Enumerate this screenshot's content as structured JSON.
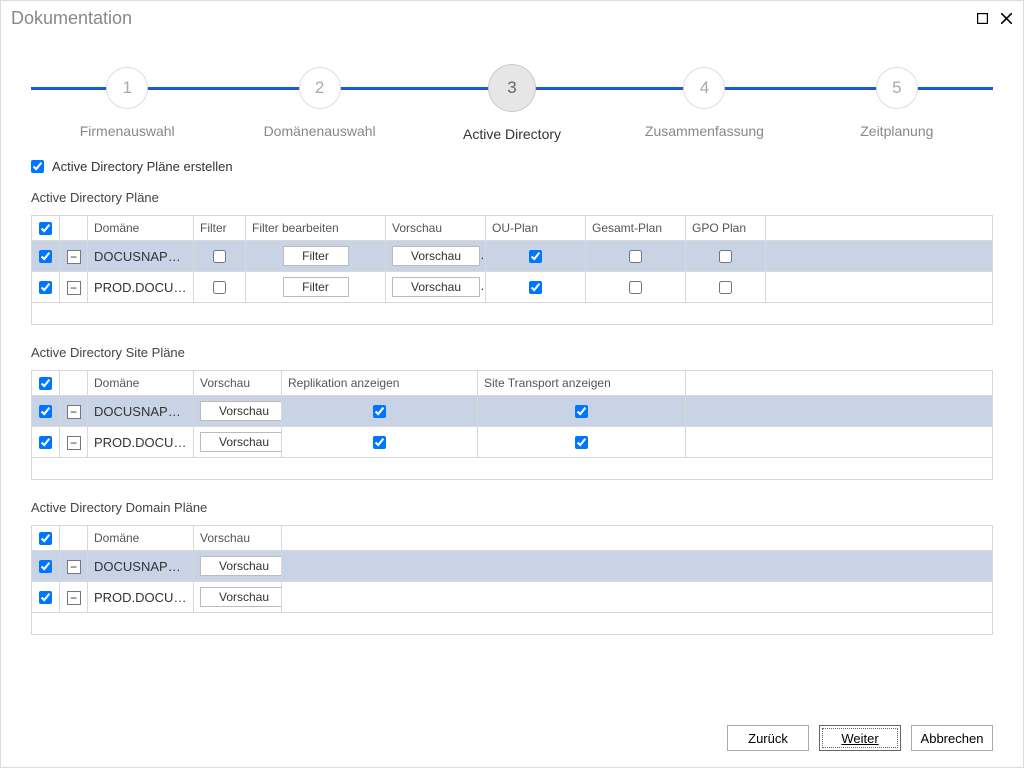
{
  "window": {
    "title": "Dokumentation"
  },
  "stepper": {
    "steps": [
      {
        "num": "1",
        "label": "Firmenauswahl"
      },
      {
        "num": "2",
        "label": "Domänenauswahl"
      },
      {
        "num": "3",
        "label": "Active Directory"
      },
      {
        "num": "4",
        "label": "Zusammenfassung"
      },
      {
        "num": "5",
        "label": "Zeitplanung"
      }
    ],
    "active": 2
  },
  "checkbox_label": "Active Directory Pläne erstellen",
  "table1": {
    "title": "Active Directory Pläne",
    "headers": {
      "domain": "Domäne",
      "filter": "Filter",
      "filter_edit": "Filter bearbeiten",
      "preview": "Vorschau",
      "ou": "OU-Plan",
      "total": "Gesamt-Plan",
      "gpo": "GPO Plan"
    },
    "rows": [
      {
        "domain": "DOCUSNAPSP...",
        "filter_btn": "Filter",
        "preview_btn": "Vorschau",
        "ou": true,
        "total": false,
        "gpo": false
      },
      {
        "domain": "PROD.DOCUS...",
        "filter_btn": "Filter",
        "preview_btn": "Vorschau",
        "ou": true,
        "total": false,
        "gpo": false
      }
    ]
  },
  "table2": {
    "title": "Active Directory Site Pläne",
    "headers": {
      "domain": "Domäne",
      "preview": "Vorschau",
      "replication": "Replikation anzeigen",
      "transport": "Site Transport anzeigen"
    },
    "rows": [
      {
        "domain": "DOCUSNAPSP...",
        "preview_btn": "Vorschau",
        "replication": true,
        "transport": true
      },
      {
        "domain": "PROD.DOCUS...",
        "preview_btn": "Vorschau",
        "replication": true,
        "transport": true
      }
    ]
  },
  "table3": {
    "title": "Active Directory Domain Pläne",
    "headers": {
      "domain": "Domäne",
      "preview": "Vorschau"
    },
    "rows": [
      {
        "domain": "DOCUSNAPSP...",
        "preview_btn": "Vorschau"
      },
      {
        "domain": "PROD.DOCUS...",
        "preview_btn": "Vorschau"
      }
    ]
  },
  "buttons": {
    "back": "Zurück",
    "next": "Weiter",
    "cancel": "Abbrechen"
  }
}
